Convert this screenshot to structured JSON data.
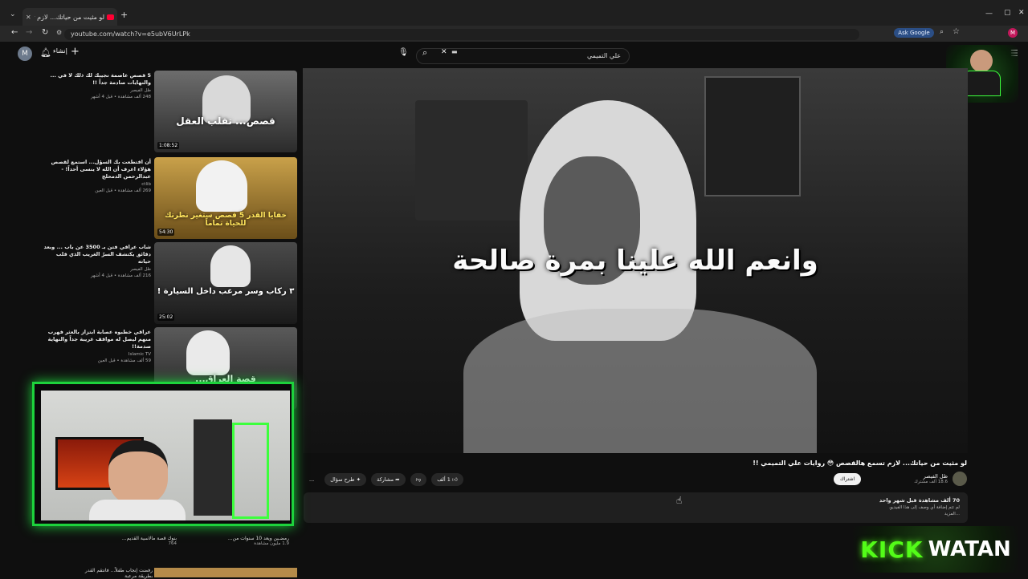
{
  "browser": {
    "tab_title": "لو مثيت من حياتك... لازم تسمـ",
    "url": "youtube.com/watch?v=e5ubV6UrLPk",
    "ask_google": "Ask Google",
    "profile_letter": "M"
  },
  "youtube": {
    "search_value": "علي التميمي",
    "create_label": "إنشاء",
    "avatar_letter": "M"
  },
  "recommendations": [
    {
      "title": "5 قصص عاصمة نجيبك لك ذلك لا في ... والنهايات صادمة جداً !!",
      "channel": "ظل الفيصر",
      "meta": "248 ألف مشاهدة • قبل 4 أشهر",
      "duration": "1:08:52",
      "caption": "قصص... تقلب العقل"
    },
    {
      "title": "أن اقتطعت بك السؤل... استمع لقصص هؤلاء اعرف أن الله لا ينسى أحداً! - عبدالرحمن الدمحلج",
      "channel": "ctlib",
      "meta": "269 ألف مشاهدة • قبل العين",
      "duration": "54:30",
      "caption": "خفايا القدر 5 قصص ستغير نظرتك للحياة تماماً"
    },
    {
      "title": "شاب عراقي فتن بـ 3500 عن باب ... وبعد دقائق يكتشف السرّ الغريب الذي قلب حياته",
      "channel": "ظل الفيصر",
      "meta": "216 ألف مشاهدة • قبل 4 أشهر",
      "duration": "25:02",
      "caption": "٣ ركاب وسر مرعب داخل السيارة !"
    },
    {
      "title": "عراقي خطبوه عصابة ابتزاز بالعثر فهرب منهم ليصل له مواقف غريبة جداً والنهاية صدمة!!",
      "channel": "Islamic TV",
      "meta": "59 ألف مشاهدة • قبل العين",
      "duration": "",
      "caption": "قصة العراق..."
    }
  ],
  "video": {
    "subtitle": "وانعم الله علينا بمرة صالحة",
    "title": "لو مثيت من حياتك... لازم تسمع هالقصص 😳 روايات علي التميمي !!",
    "channel_name": "ظل الفيصر",
    "subscribers": "18.6 ألف مشترك",
    "subscribe_label": "اشتراك",
    "like_label": "1 ألف",
    "share_label": "مشاركة",
    "ask_label": "طرح سؤال",
    "more_label": "...",
    "description_meta": "70 ألف مشاهدة قبل شهر واحد",
    "description_text": "لم تتم إضافة أي وصف إلى هذا الفيديو.",
    "description_more": "...المزيد"
  },
  "bottom_list": [
    {
      "title": "رمضـين ويعد 10 سنوات من...",
      "meta": "1.9 مليون مشاهدة"
    },
    {
      "title": "بنوك قصة مالاسية القديم...",
      "meta": "764"
    },
    {
      "title": "رفضت إنجاب طفلاً... فانتقم القدر بطريقة مرعبة",
      "meta": ""
    }
  ],
  "kick": {
    "word1": "KICK",
    "word2": "WATAN"
  }
}
